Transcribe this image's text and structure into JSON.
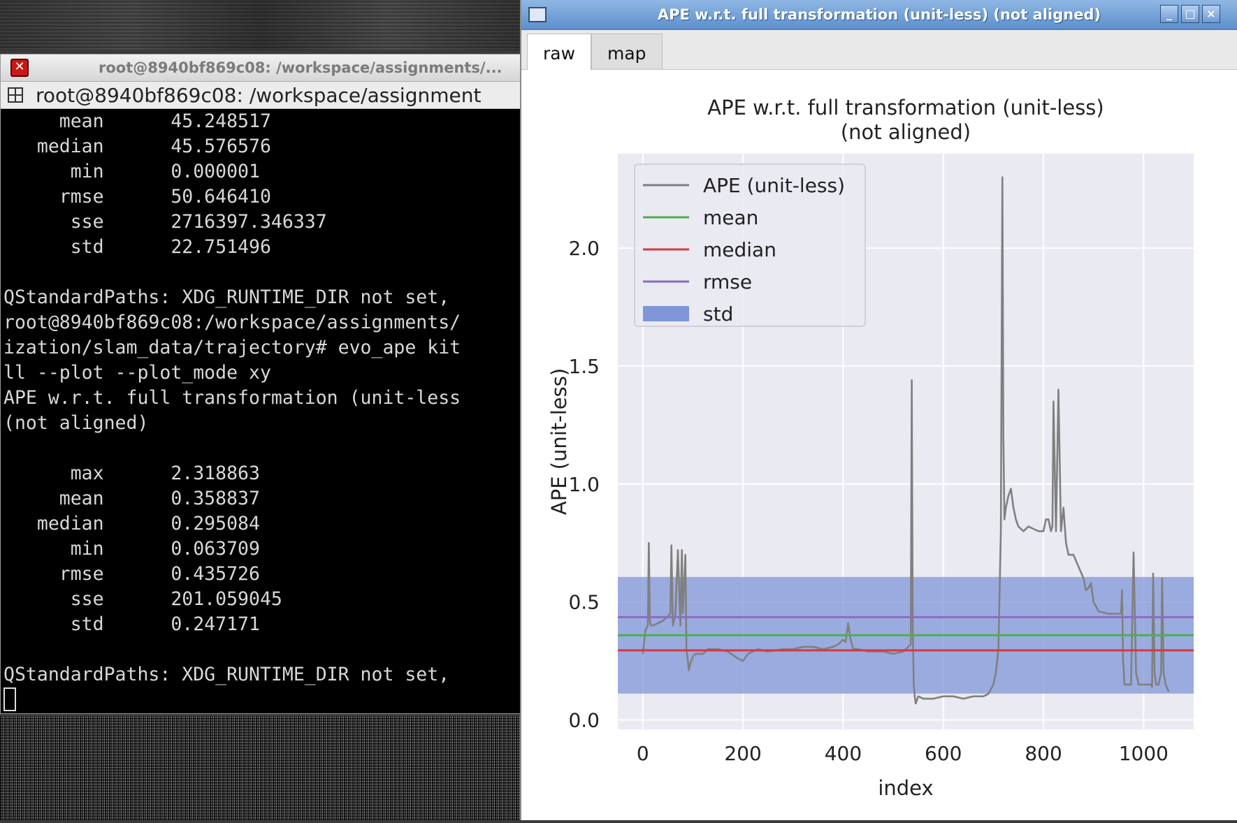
{
  "terminal": {
    "window_title": "root@8940bf869c08: /workspace/assignments/...",
    "tab_label": "root@8940bf869c08: /workspace/assignment",
    "lines": [
      "     mean      45.248517",
      "   median      45.576576",
      "      min      0.000001",
      "     rmse      50.646410",
      "      sse      2716397.346337",
      "      std      22.751496",
      "",
      "QStandardPaths: XDG_RUNTIME_DIR not set,",
      "root@8940bf869c08:/workspace/assignments/",
      "ization/slam_data/trajectory# evo_ape kit",
      "ll --plot --plot_mode xy",
      "APE w.r.t. full transformation (unit-less",
      "(not aligned)",
      "",
      "      max      2.318863",
      "     mean      0.358837",
      "   median      0.295084",
      "      min      0.063709",
      "     rmse      0.435726",
      "      sse      201.059045",
      "      std      0.247171",
      "",
      "QStandardPaths: XDG_RUNTIME_DIR not set,"
    ]
  },
  "plot_window": {
    "title": "APE w.r.t. full transformation (unit-less) (not aligned)",
    "tabs": [
      "raw",
      "map"
    ],
    "btn_min": "_",
    "btn_max": "□",
    "btn_close": "×"
  },
  "chart_data": {
    "type": "line",
    "title_line1": "APE w.r.t. full transformation (unit-less)",
    "title_line2": "(not aligned)",
    "xlabel": "index",
    "ylabel": "APE (unit-less)",
    "xlim": [
      -50,
      1100
    ],
    "ylim": [
      -0.04,
      2.4
    ],
    "xticks": [
      0,
      200,
      400,
      600,
      800,
      1000
    ],
    "yticks": [
      0.0,
      0.5,
      1.0,
      1.5,
      2.0
    ],
    "xtick_labels": [
      "0",
      "200",
      "400",
      "600",
      "800",
      "1000"
    ],
    "ytick_labels": [
      "0.0",
      "0.5",
      "1.0",
      "1.5",
      "2.0"
    ],
    "grid": true,
    "legend_position": "top-left",
    "legend": [
      "APE (unit-less)",
      "mean",
      "median",
      "rmse",
      "std"
    ],
    "stats": {
      "mean": 0.358837,
      "median": 0.295084,
      "rmse": 0.435726,
      "std": 0.247171
    },
    "colors": {
      "ape": "#808080",
      "mean": "#4caf50",
      "median": "#d9363e",
      "rmse": "#8a6bc4",
      "std": "#7f97d8",
      "axes_bg": "#eaeaf2"
    },
    "series": [
      {
        "name": "APE (unit-less)",
        "x": [
          0,
          5,
          10,
          12,
          14,
          16,
          20,
          40,
          55,
          57,
          60,
          62,
          65,
          70,
          75,
          78,
          80,
          82,
          85,
          87,
          90,
          92,
          95,
          100,
          105,
          110,
          120,
          130,
          150,
          170,
          190,
          200,
          210,
          230,
          250,
          280,
          300,
          320,
          340,
          360,
          380,
          390,
          400,
          405,
          410,
          415,
          420,
          430,
          450,
          480,
          500,
          520,
          530,
          535,
          537,
          539,
          541,
          543,
          545,
          550,
          560,
          580,
          600,
          620,
          640,
          660,
          680,
          690,
          700,
          705,
          710,
          715,
          718,
          720,
          722,
          725,
          730,
          735,
          740,
          745,
          750,
          760,
          770,
          780,
          790,
          800,
          805,
          810,
          815,
          818,
          820,
          825,
          830,
          835,
          840,
          845,
          850,
          860,
          870,
          880,
          885,
          890,
          895,
          900,
          910,
          930,
          950,
          955,
          957,
          959,
          962,
          965,
          975,
          980,
          985,
          990,
          1000,
          1010,
          1015,
          1017,
          1019,
          1022,
          1025,
          1030,
          1035,
          1037,
          1040,
          1044,
          1046,
          1050
        ],
        "y": [
          0.28,
          0.38,
          0.4,
          0.75,
          0.42,
          0.4,
          0.4,
          0.42,
          0.45,
          0.74,
          0.4,
          0.42,
          0.45,
          0.72,
          0.4,
          0.72,
          0.45,
          0.55,
          0.7,
          0.3,
          0.25,
          0.21,
          0.24,
          0.27,
          0.28,
          0.28,
          0.28,
          0.3,
          0.3,
          0.29,
          0.26,
          0.25,
          0.28,
          0.3,
          0.29,
          0.3,
          0.3,
          0.31,
          0.31,
          0.3,
          0.31,
          0.32,
          0.34,
          0.33,
          0.41,
          0.34,
          0.3,
          0.3,
          0.29,
          0.29,
          0.28,
          0.29,
          0.31,
          0.32,
          1.44,
          0.4,
          0.15,
          0.1,
          0.07,
          0.1,
          0.09,
          0.09,
          0.1,
          0.1,
          0.09,
          0.1,
          0.1,
          0.11,
          0.15,
          0.2,
          0.3,
          0.8,
          2.3,
          1.2,
          0.85,
          0.9,
          0.95,
          0.98,
          0.9,
          0.85,
          0.82,
          0.8,
          0.82,
          0.81,
          0.8,
          0.8,
          0.85,
          0.85,
          0.8,
          0.82,
          1.35,
          0.8,
          1.4,
          0.8,
          0.9,
          0.75,
          0.7,
          0.7,
          0.65,
          0.6,
          0.55,
          0.56,
          0.58,
          0.5,
          0.46,
          0.45,
          0.45,
          0.45,
          0.55,
          0.25,
          0.15,
          0.15,
          0.15,
          0.71,
          0.2,
          0.15,
          0.15,
          0.15,
          0.15,
          0.14,
          0.62,
          0.2,
          0.15,
          0.15,
          0.2,
          0.6,
          0.2,
          0.15,
          0.14,
          0.12
        ]
      }
    ]
  }
}
